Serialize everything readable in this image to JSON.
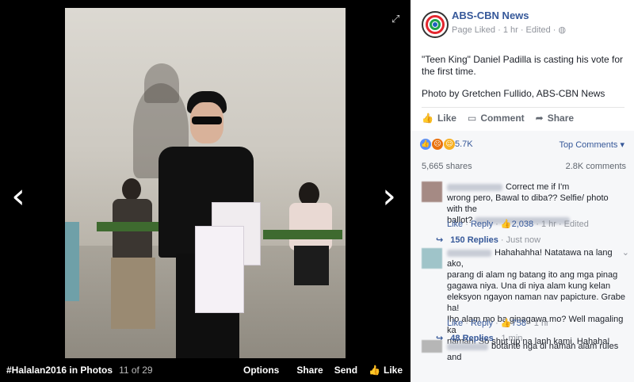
{
  "viewer": {
    "prev_icon": "chevron-left-icon",
    "next_icon": "chevron-right-icon",
    "expand_icon": "expand-icon",
    "album_title": "#Halalan2016 in Photos",
    "position": "11 of 29",
    "options_label": "Options",
    "share_label": "Share",
    "send_label": "Send",
    "like_label": "Like"
  },
  "page": {
    "name": "ABS-CBN News",
    "meta": "Page Liked · 1 hr · Edited · ",
    "post_text": "\"Teen King\" Daniel Padilla is casting his vote for the first time.",
    "credit": "Photo by Gretchen Fullido, ABS-CBN News"
  },
  "actions": {
    "like": "Like",
    "comment": "Comment",
    "share": "Share"
  },
  "reactions": {
    "count": "5.7K",
    "sort_label": "Top Comments ▾",
    "shares": "5,665 shares",
    "comments": "2.8K comments",
    "colors": {
      "like": "#5890ff",
      "angry": "#e9710f",
      "haha": "#f7b125"
    }
  },
  "comments": [
    {
      "text_a": "Correct me if I'm",
      "text_b": "wrong pero, Bawal to diba?? Selfie/ photo with the",
      "text_c": "ballot?",
      "like": "Like",
      "reply": "Reply",
      "likes": "2,038",
      "time": "1 hr · Edited",
      "replies": "150 Replies",
      "replies_time": "· Just now"
    },
    {
      "lines": [
        "Hahahahha! Natatawa na lang ako,",
        "parang di alam ng batang ito ang mga pinag",
        "gagawa niya. Una di niya alam kung kelan",
        "eleksyon ngayon naman nav papicture. Grabe ha!",
        "Iho alam mo ba ginagawa mo? Well magaling ka",
        "naman. So shut up na lanh kami. Hahaha!"
      ],
      "like": "Like",
      "reply": "Reply",
      "likes": "758",
      "time": "1 hr",
      "replies": "48 Replies",
      "replies_time": "· 1 min"
    },
    {
      "text": "botante nga di naman alam rules and"
    }
  ]
}
